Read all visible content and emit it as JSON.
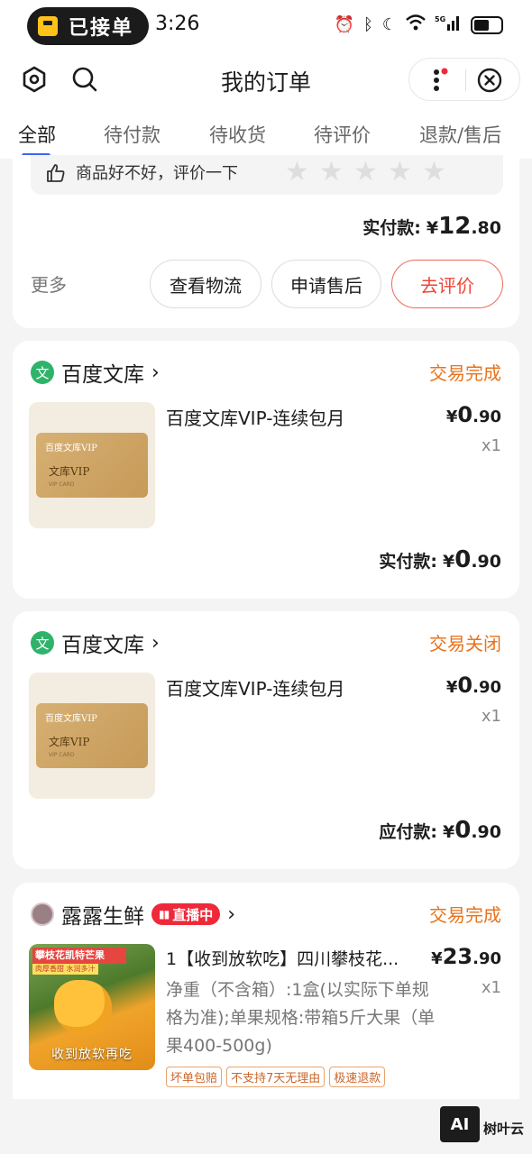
{
  "status_bar": {
    "pill_text": "已接单",
    "time": "3:26",
    "network": "5G"
  },
  "header": {
    "title": "我的订单"
  },
  "tabs": [
    {
      "label": "全部"
    },
    {
      "label": "待付款"
    },
    {
      "label": "待收货"
    },
    {
      "label": "待评价"
    },
    {
      "label": "退款/售后"
    }
  ],
  "order1": {
    "rate_prompt": "商品好不好，评价一下",
    "pay_label": "实付款:",
    "currency": "¥",
    "amount_int": "12",
    "amount_dec": ".80",
    "more": "更多",
    "buttons": [
      "查看物流",
      "申请售后",
      "去评价"
    ]
  },
  "order2": {
    "shop": "百度文库",
    "shop_logo": "文",
    "status": "交易完成",
    "item_title": "百度文库VIP-连续包月",
    "thumb_logo": "百度文库VIP",
    "thumb_name": "文库VIP",
    "thumb_sub": "VIP CARD",
    "currency": "¥",
    "price_int": "0",
    "price_dec": ".90",
    "qty": "x1",
    "pay_label": "实付款:",
    "total_int": "0",
    "total_dec": ".90"
  },
  "order3": {
    "shop": "百度文库",
    "shop_logo": "文",
    "status": "交易关闭",
    "item_title": "百度文库VIP-连续包月",
    "thumb_logo": "百度文库VIP",
    "thumb_name": "文库VIP",
    "thumb_sub": "VIP CARD",
    "currency": "¥",
    "price_int": "0",
    "price_dec": ".90",
    "qty": "x1",
    "pay_label": "应付款:",
    "total_int": "0",
    "total_dec": ".90"
  },
  "order4": {
    "shop": "露露生鲜",
    "live_label": "直播中",
    "status": "交易完成",
    "item_title": "1【收到放软吃】四川攀枝花...",
    "item_spec": "净重（不含箱）:1盒(以实际下单规格为准);单果规格:带箱5斤大果（单果400-500g)",
    "currency": "¥",
    "price_int": "23",
    "price_dec": ".90",
    "qty": "x1",
    "thumb_banner": "攀枝花凯特芒果",
    "thumb_sub": "肉厚香甜 水润多汁",
    "thumb_caption": "收到放软再吃",
    "tags": [
      "坏单包赔",
      "不支持7天无理由",
      "极速退款"
    ]
  },
  "watermark": {
    "ai_badge": "AI",
    "brand": "树叶云"
  },
  "colors": {
    "accent_blue": "#3f63f5",
    "status_orange": "#e8731c",
    "red": "#f04436",
    "live_red": "#ee2a3a"
  }
}
